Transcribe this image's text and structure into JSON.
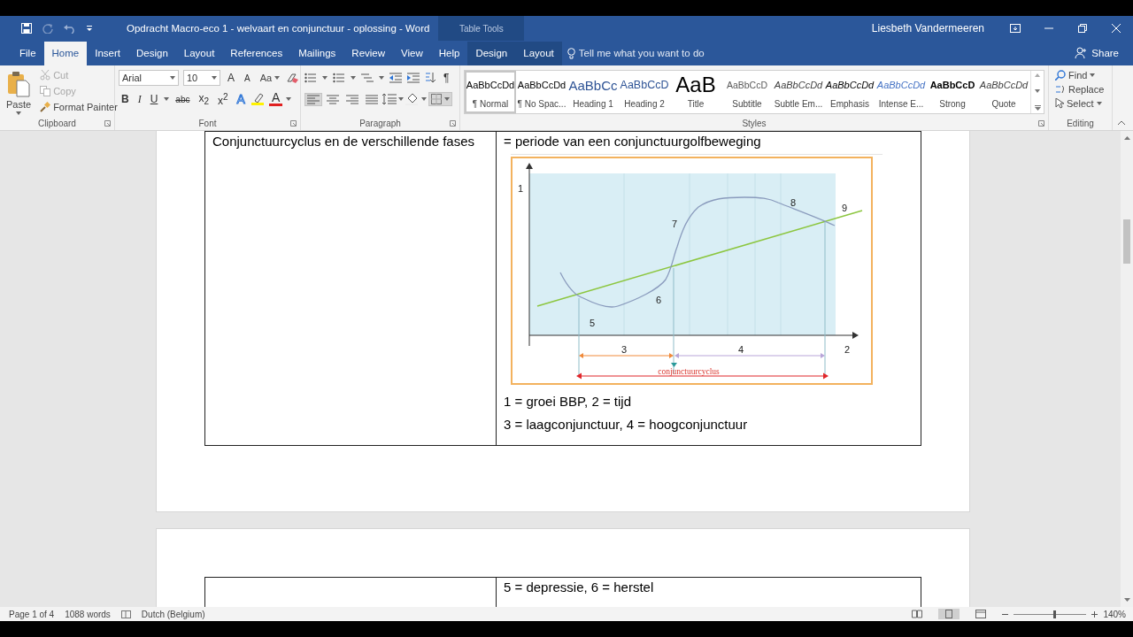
{
  "window": {
    "title": "Opdracht Macro-eco 1 - welvaart en conjunctuur - oplossing  -  Word",
    "contextual_group": "Table Tools",
    "user": "Liesbeth Vandermeeren"
  },
  "tabs": [
    {
      "label": "File",
      "selected": false,
      "contextual": false
    },
    {
      "label": "Home",
      "selected": true,
      "contextual": false
    },
    {
      "label": "Insert",
      "selected": false,
      "contextual": false
    },
    {
      "label": "Design",
      "selected": false,
      "contextual": false
    },
    {
      "label": "Layout",
      "selected": false,
      "contextual": false
    },
    {
      "label": "References",
      "selected": false,
      "contextual": false
    },
    {
      "label": "Mailings",
      "selected": false,
      "contextual": false
    },
    {
      "label": "Review",
      "selected": false,
      "contextual": false
    },
    {
      "label": "View",
      "selected": false,
      "contextual": false
    },
    {
      "label": "Help",
      "selected": false,
      "contextual": false
    },
    {
      "label": "Design",
      "selected": false,
      "contextual": true
    },
    {
      "label": "Layout",
      "selected": false,
      "contextual": true
    }
  ],
  "tell_me": {
    "placeholder": "Tell me what you want to do"
  },
  "share": "Share",
  "ribbon": {
    "clipboard": {
      "label": "Clipboard",
      "paste": "Paste",
      "items": [
        {
          "label": "Cut",
          "disabled": true
        },
        {
          "label": "Copy",
          "disabled": true
        },
        {
          "label": "Format Painter",
          "disabled": false
        }
      ]
    },
    "font": {
      "label": "Font",
      "name": "Arial",
      "size": "10",
      "grow": "A",
      "shrink": "A",
      "change_case": "Aa",
      "format_buttons": [
        {
          "kind": "bold",
          "text": "B"
        },
        {
          "kind": "italic",
          "text": "I"
        },
        {
          "kind": "underline",
          "text": "U"
        },
        {
          "kind": "strike",
          "text": "abc"
        },
        {
          "kind": "script",
          "text": "x$_{2}$"
        },
        {
          "kind": "script",
          "text": "x$^{2}$"
        }
      ],
      "text_effects": "A",
      "font_color": "A"
    },
    "paragraph": {
      "label": "Paragraph",
      "show_marks": "¶",
      "alignments": [
        {
          "selected": true
        },
        {
          "selected": false
        },
        {
          "selected": false
        },
        {
          "selected": false
        }
      ],
      "borders": {
        "selected": true
      }
    },
    "styles": {
      "label": "Styles",
      "items": [
        {
          "kind": "normal",
          "preview": "AaBbCcDd",
          "name": "¶ Normal",
          "selected": true
        },
        {
          "kind": "normal",
          "preview": "AaBbCcDd",
          "name": "¶ No Spac...",
          "selected": false
        },
        {
          "kind": "heading1",
          "preview": "AaBbCc",
          "name": "Heading 1",
          "selected": false
        },
        {
          "kind": "heading2",
          "preview": "AaBbCcD",
          "name": "Heading 2",
          "selected": false
        },
        {
          "kind": "title",
          "preview": "AaB",
          "name": "Title",
          "selected": false
        },
        {
          "kind": "subtitle",
          "preview": "AaBbCcD",
          "name": "Subtitle",
          "selected": false
        },
        {
          "kind": "subtle",
          "preview": "AaBbCcDd",
          "name": "Subtle Em...",
          "selected": false
        },
        {
          "kind": "emphasis",
          "preview": "AaBbCcDd",
          "name": "Emphasis",
          "selected": false
        },
        {
          "kind": "intense",
          "preview": "AaBbCcDd",
          "name": "Intense E...",
          "selected": false
        },
        {
          "kind": "strong",
          "preview": "AaBbCcD",
          "name": "Strong",
          "selected": false
        },
        {
          "kind": "quote",
          "preview": "AaBbCcDd",
          "name": "Quote",
          "selected": false
        }
      ]
    },
    "editing": {
      "label": "Editing",
      "find": "Find",
      "replace": "Replace",
      "select": "Select"
    }
  },
  "document": {
    "pages": [
      {
        "rows": [
          {
            "left": "Conjunctuurcyclus en de verschillende fases",
            "right": "= periode van een conjunctuurgolfbeweging",
            "figure": {
              "labels": [
                "1",
                "8",
                "9",
                "7",
                "6",
                "5",
                "3",
                "4",
                "2"
              ],
              "cycle_label": "conjunctuurcyclus"
            },
            "notes": [
              "1 = groei BBP, 2 = tijd",
              "3 = laagconjunctuur, 4 = hoogconjunctuur"
            ]
          }
        ]
      },
      {
        "rows": [
          {
            "left": "",
            "right": "5 = depressie, 6 = herstel"
          }
        ]
      }
    ]
  },
  "status_bar": {
    "page": "Page 1 of 4",
    "words": "1088 words",
    "language": "Dutch (Belgium)",
    "views": [
      {
        "selected": false
      },
      {
        "selected": true
      },
      {
        "selected": false
      }
    ],
    "zoom": {
      "level": 0.54,
      "reading": "140%"
    }
  }
}
